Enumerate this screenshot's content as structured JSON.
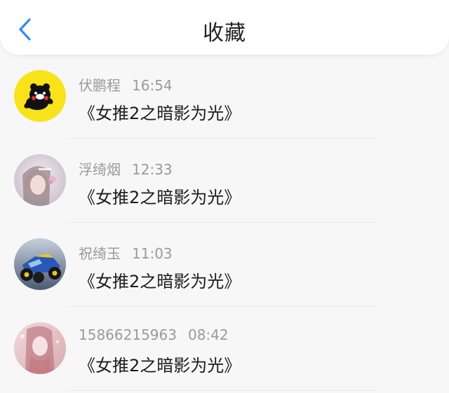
{
  "header": {
    "title": "收藏",
    "back_icon": "chevron-left-icon",
    "accent": "#2f8cf0"
  },
  "items": [
    {
      "name": "伏鹏程",
      "time": "16:54",
      "content": "《女推2之暗影为光》",
      "avatar_bg": "#f8e31a"
    },
    {
      "name": "浮绮烟",
      "time": "12:33",
      "content": "《女推2之暗影为光》",
      "avatar_bg": "#e9e2ea"
    },
    {
      "name": "祝绮玉",
      "time": "11:03",
      "content": "《女推2之暗影为光》",
      "avatar_bg": "#6a7d9c"
    },
    {
      "name": "15866215963",
      "time": "08:42",
      "content": "《女推2之暗影为光》",
      "avatar_bg": "#ead1d4"
    }
  ]
}
